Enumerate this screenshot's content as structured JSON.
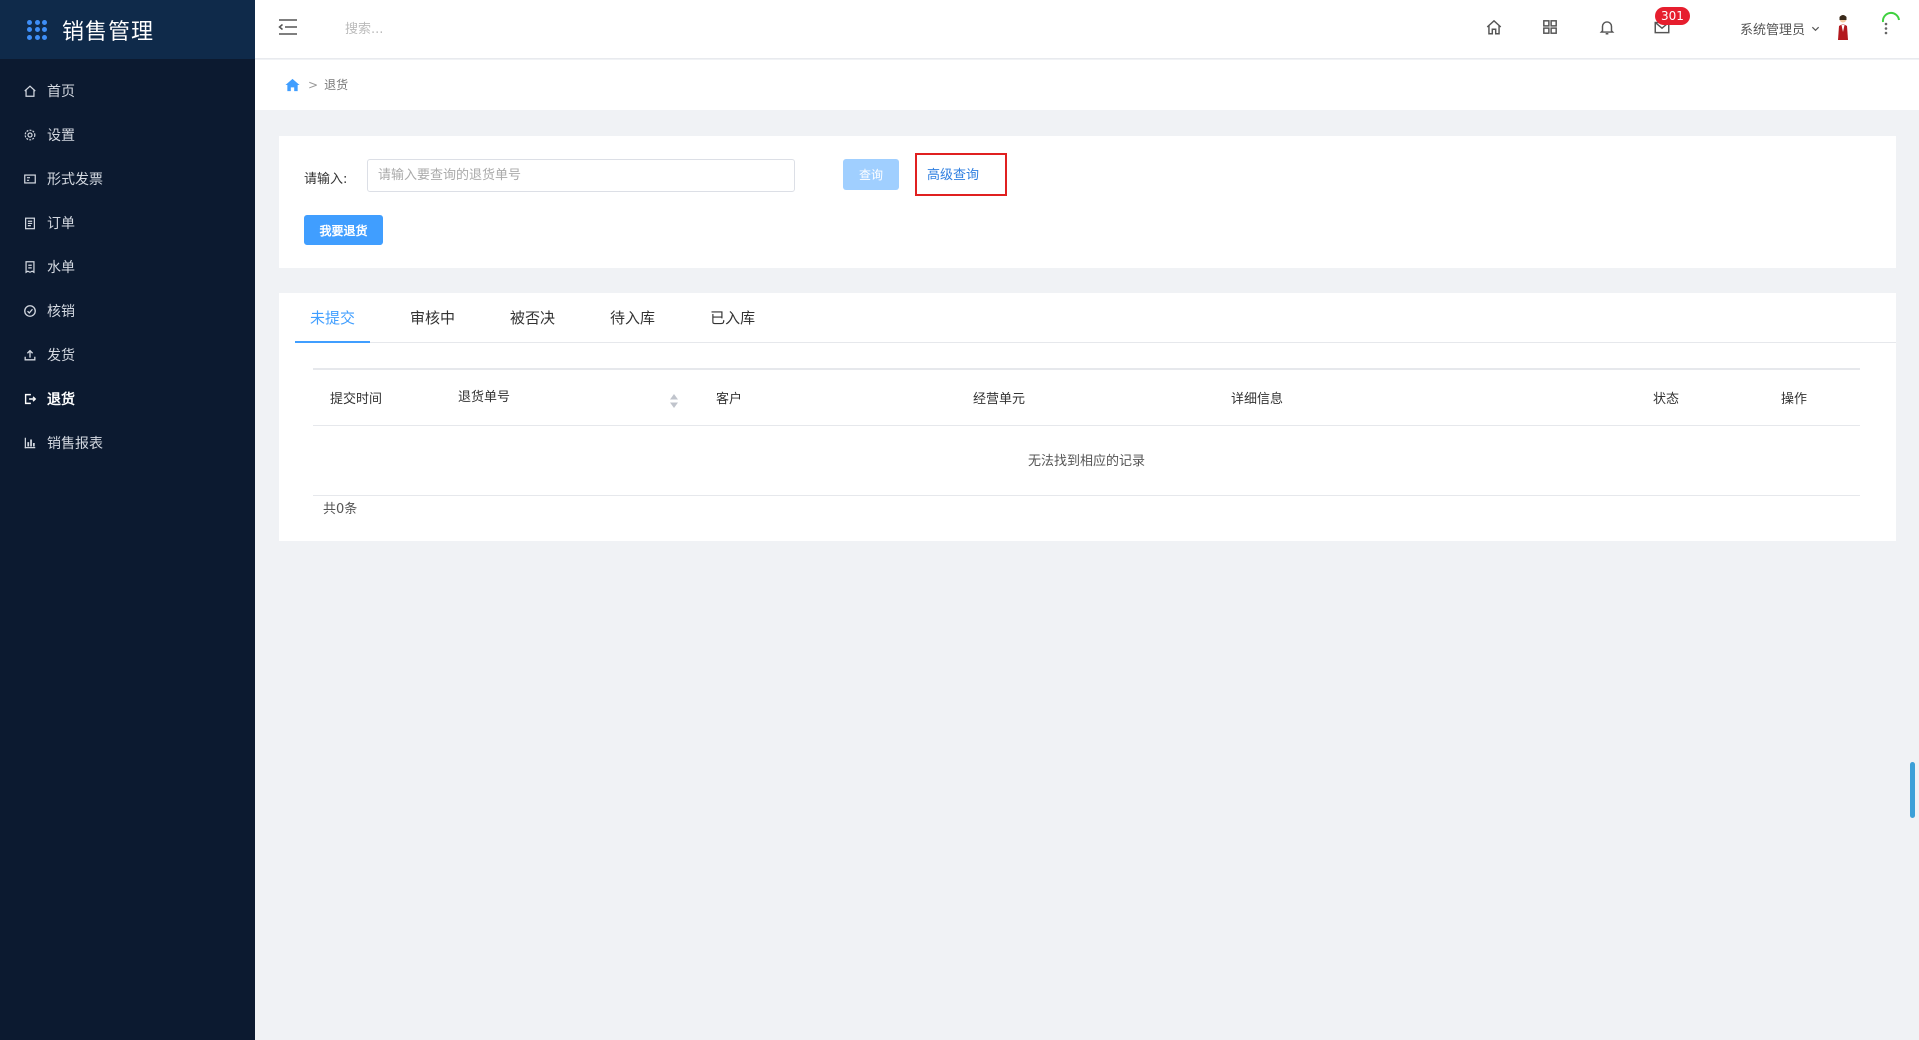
{
  "app": {
    "title": "销售管理"
  },
  "sidebar": {
    "items": [
      {
        "label": "首页",
        "icon": "home-icon"
      },
      {
        "label": "设置",
        "icon": "gear-icon"
      },
      {
        "label": "形式发票",
        "icon": "invoice-icon"
      },
      {
        "label": "订单",
        "icon": "clipboard-icon"
      },
      {
        "label": "水单",
        "icon": "receipt-icon"
      },
      {
        "label": "核销",
        "icon": "check-circle-icon"
      },
      {
        "label": "发货",
        "icon": "upload-icon"
      },
      {
        "label": "退货",
        "icon": "logout-icon",
        "active": true
      },
      {
        "label": "销售报表",
        "icon": "bar-chart-icon"
      }
    ]
  },
  "topbar": {
    "search_placeholder": "搜索...",
    "badge_count": "301",
    "user_name": "系统管理员"
  },
  "breadcrumb": {
    "current": "退货"
  },
  "search_panel": {
    "input_label": "请输入:",
    "input_placeholder": "请输入要查询的退货单号",
    "query_button": "查询",
    "advanced_link": "高级查询",
    "return_button": "我要退货"
  },
  "tabs": [
    "未提交",
    "审核中",
    "被否决",
    "待入库",
    "已入库"
  ],
  "table": {
    "columns": [
      "提交时间",
      "退货单号",
      "客户",
      "经营单元",
      "详细信息",
      "状态",
      "操作"
    ],
    "empty_text": "无法找到相应的记录",
    "total_text": "共0条"
  },
  "colors": {
    "sidebar_bg": "#0c1a30",
    "accent": "#409eff",
    "badge": "#e61e2e",
    "highlight_box": "#e02020"
  }
}
